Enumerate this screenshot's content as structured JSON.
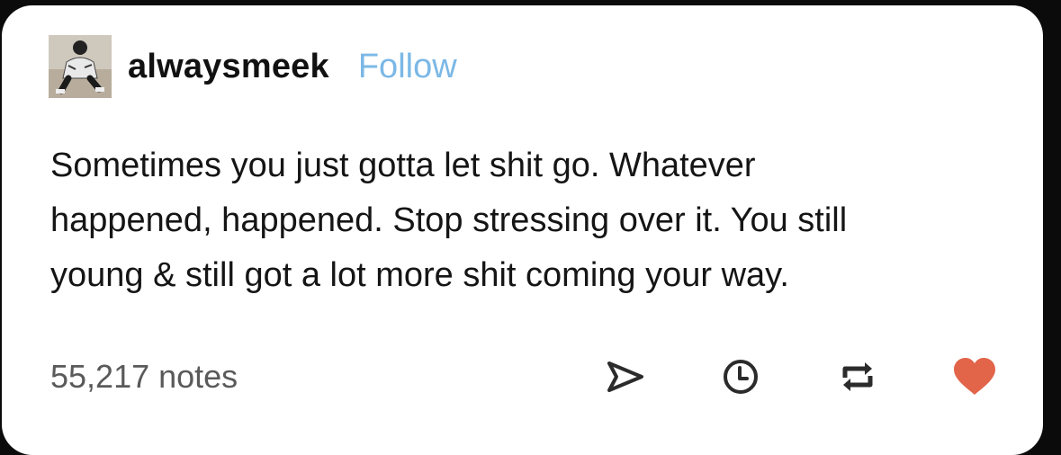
{
  "post": {
    "username": "alwaysmeek",
    "follow_label": "Follow",
    "text_lines": [
      "Sometimes you just gotta let shit go. Whatever",
      "happened, happened. Stop stressing over it. You still",
      "young & still got a lot more shit coming your way."
    ],
    "notes": "55,217 notes"
  },
  "actions": [
    {
      "icon": "share-icon"
    },
    {
      "icon": "clock-icon"
    },
    {
      "icon": "reblog-icon"
    },
    {
      "icon": "heart-icon"
    }
  ],
  "colors": {
    "follow": "#7bb8e6",
    "heart": "#e2654a",
    "icon": "#2b2b2b",
    "background": "#0b0b0b"
  }
}
